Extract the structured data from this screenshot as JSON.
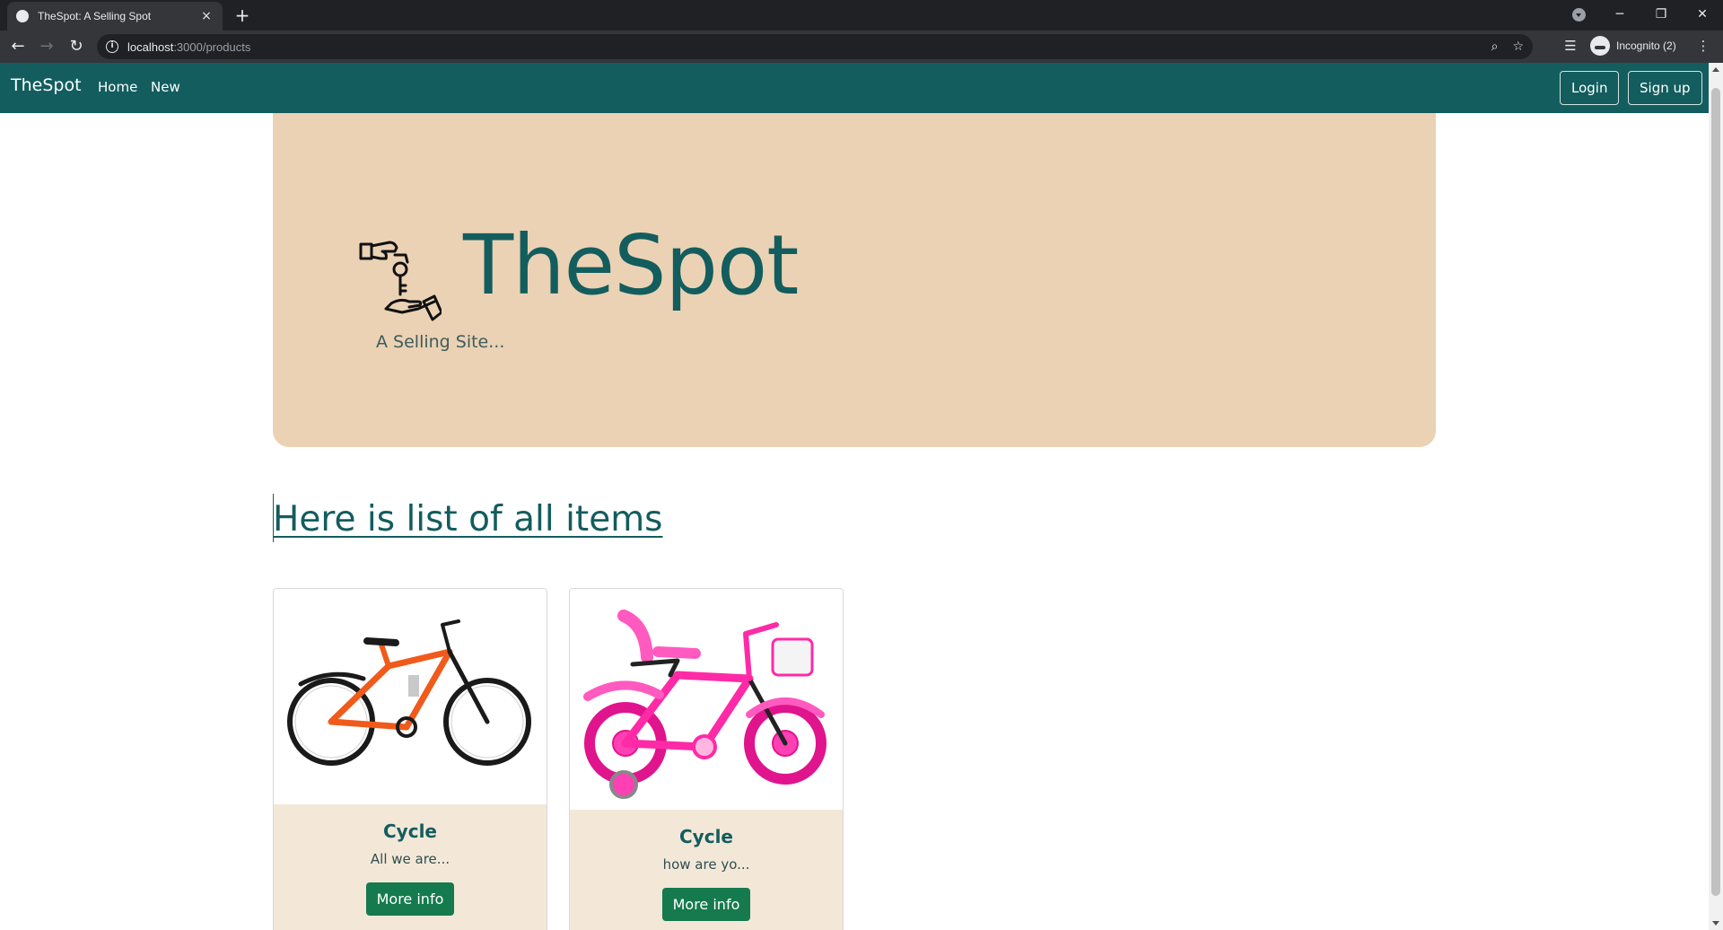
{
  "browser": {
    "tab_title": "TheSpot: A Selling Spot",
    "tab_close": "×",
    "new_tab": "+",
    "url_host": "localhost",
    "url_path": ":3000/products",
    "profile_label": "Incognito (2)",
    "window_controls": {
      "minimize": "─",
      "maximize": "❐",
      "close": "✕"
    },
    "icons": [
      "back-icon",
      "forward-icon",
      "reload-icon",
      "info-icon",
      "zoom-icon",
      "bookmark-star-icon",
      "reading-list-icon",
      "incognito-icon",
      "menu-icon"
    ]
  },
  "navbar": {
    "brand": "TheSpot",
    "links": [
      "Home",
      "New"
    ],
    "login_label": "Login",
    "signup_label": "Sign up"
  },
  "hero": {
    "icon": "hand-with-key-icon",
    "title": "TheSpot",
    "subtitle": "A Selling Site..."
  },
  "list": {
    "heading": "Here is list of all items"
  },
  "products": [
    {
      "image": "orange-bicycle",
      "title": "Cycle",
      "description": "All we are...",
      "button": "More info"
    },
    {
      "image": "pink-kids-bicycle",
      "title": "Cycle",
      "description": "how are yo...",
      "button": "More info"
    }
  ],
  "colors": {
    "navbar": "#135d5e",
    "hero_background": "#ebd2b4",
    "card_body": "#f3e7d8",
    "button": "#157a4d",
    "heading": "#135d5e"
  }
}
